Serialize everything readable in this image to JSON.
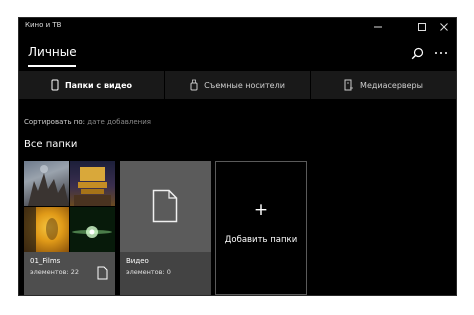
{
  "app": {
    "title": "Кино и ТВ"
  },
  "header": {
    "title": "Личные"
  },
  "tabs": [
    {
      "label": "Папки с видео",
      "icon": "phone-icon",
      "active": true
    },
    {
      "label": "Съемные носители",
      "icon": "usb-drive-icon",
      "active": false
    },
    {
      "label": "Медиасерверы",
      "icon": "media-server-icon",
      "active": false
    }
  ],
  "sort": {
    "label": "Сортировать по:",
    "value": "дате добавления"
  },
  "section": {
    "title": "Все папки"
  },
  "folders": [
    {
      "name": "01_Films",
      "count": "элементов: 22"
    },
    {
      "name": "Видео",
      "count": "элементов: 0"
    }
  ],
  "add_folder": {
    "label": "Добавить папки",
    "plus": "+"
  },
  "colors": {
    "background": "#000000",
    "tab_bar": "#191919",
    "tile": "#4e4e4e",
    "accent": "#ffffff"
  }
}
